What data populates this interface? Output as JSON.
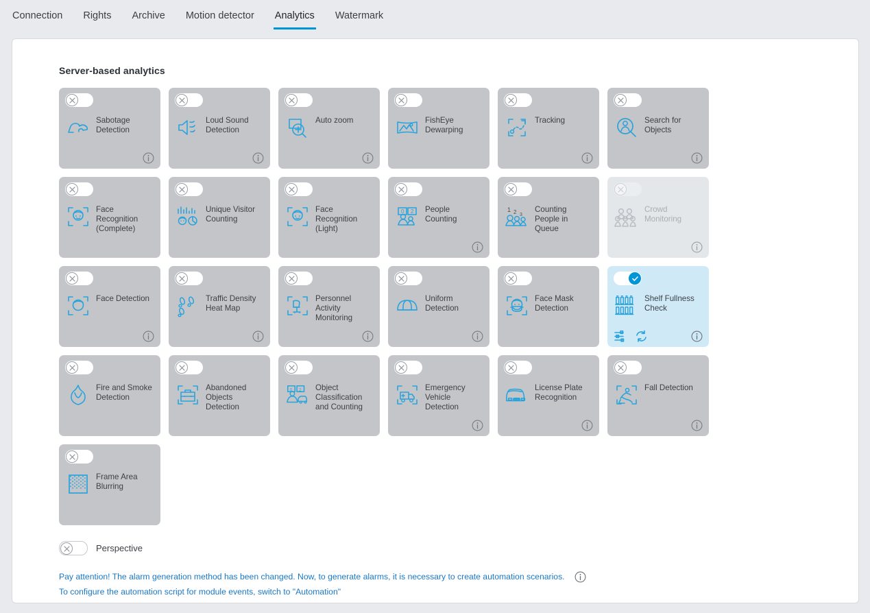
{
  "tabs": [
    {
      "label": "Connection",
      "active": false
    },
    {
      "label": "Rights",
      "active": false
    },
    {
      "label": "Archive",
      "active": false
    },
    {
      "label": "Motion detector",
      "active": false
    },
    {
      "label": "Analytics",
      "active": true
    },
    {
      "label": "Watermark",
      "active": false
    }
  ],
  "accent_color": "#0095d9",
  "link_color": "#1878c8",
  "card_bg": "#c3c5c9",
  "card_bg_active": "#cfe9f7",
  "card_bg_disabled": "#e4e7ea",
  "section": {
    "title": "Server-based analytics"
  },
  "cards": [
    {
      "label": "Sabotage Detection",
      "icon": "sabotage-icon",
      "enabled": false,
      "disabled": false,
      "info": true
    },
    {
      "label": "Loud Sound Detection",
      "icon": "loud-sound-icon",
      "enabled": false,
      "disabled": false,
      "info": true
    },
    {
      "label": "Auto zoom",
      "icon": "auto-zoom-icon",
      "enabled": false,
      "disabled": false,
      "info": true
    },
    {
      "label": "FishEye Dewarping",
      "icon": "fisheye-dewarping-icon",
      "enabled": false,
      "disabled": false,
      "info": false
    },
    {
      "label": "Tracking",
      "icon": "tracking-icon",
      "enabled": false,
      "disabled": false,
      "info": true
    },
    {
      "label": "Search for Objects",
      "icon": "search-objects-icon",
      "enabled": false,
      "disabled": false,
      "info": true
    },
    {
      "label": "Face Recognition (Complete)",
      "icon": "face-recognition-icon",
      "enabled": false,
      "disabled": false,
      "info": false
    },
    {
      "label": "Unique Visitor Counting",
      "icon": "unique-visitor-icon",
      "enabled": false,
      "disabled": false,
      "info": false
    },
    {
      "label": "Face Recognition (Light)",
      "icon": "face-recognition-icon",
      "enabled": false,
      "disabled": false,
      "info": false
    },
    {
      "label": "People Counting",
      "icon": "people-counting-icon",
      "enabled": false,
      "disabled": false,
      "info": true
    },
    {
      "label": "Counting People in Queue",
      "icon": "queue-counting-icon",
      "enabled": false,
      "disabled": false,
      "info": false
    },
    {
      "label": "Crowd Monitoring",
      "icon": "crowd-monitoring-icon",
      "enabled": false,
      "disabled": true,
      "info": true
    },
    {
      "label": "Face Detection",
      "icon": "face-detection-icon",
      "enabled": false,
      "disabled": false,
      "info": true
    },
    {
      "label": "Traffic Density Heat Map",
      "icon": "heat-map-icon",
      "enabled": false,
      "disabled": false,
      "info": true
    },
    {
      "label": "Personnel Activity Monitoring",
      "icon": "personnel-activity-icon",
      "enabled": false,
      "disabled": false,
      "info": true
    },
    {
      "label": "Uniform Detection",
      "icon": "uniform-detection-icon",
      "enabled": false,
      "disabled": false,
      "info": true
    },
    {
      "label": "Face Mask Detection",
      "icon": "face-mask-icon",
      "enabled": false,
      "disabled": false,
      "info": false
    },
    {
      "label": "Shelf Fullness Check",
      "icon": "shelf-fullness-icon",
      "enabled": true,
      "disabled": false,
      "info": true,
      "tools": [
        "settings-sliders-icon",
        "refresh-icon"
      ]
    },
    {
      "label": "Fire and Smoke Detection",
      "icon": "fire-smoke-icon",
      "enabled": false,
      "disabled": false,
      "info": false
    },
    {
      "label": "Abandoned Objects Detection",
      "icon": "abandoned-objects-icon",
      "enabled": false,
      "disabled": false,
      "info": false
    },
    {
      "label": "Object Classification and Counting",
      "icon": "object-classification-icon",
      "enabled": false,
      "disabled": false,
      "info": false
    },
    {
      "label": "Emergency Vehicle Detection",
      "icon": "emergency-vehicle-icon",
      "enabled": false,
      "disabled": false,
      "info": true
    },
    {
      "label": "License Plate Recognition",
      "icon": "license-plate-icon",
      "enabled": false,
      "disabled": false,
      "info": true
    },
    {
      "label": "Fall Detection",
      "icon": "fall-detection-icon",
      "enabled": false,
      "disabled": false,
      "info": true
    },
    {
      "label": "Frame Area Blurring",
      "icon": "frame-blur-icon",
      "enabled": false,
      "disabled": false,
      "info": false
    }
  ],
  "perspective": {
    "label": "Perspective",
    "enabled": false
  },
  "notes": [
    {
      "text": "Pay attention! The alarm generation method has been changed. Now, to generate alarms, it is necessary to create automation scenarios.",
      "info": true
    },
    {
      "text": "To configure the automation script for module events, switch to \"Automation\"",
      "info": false
    }
  ]
}
